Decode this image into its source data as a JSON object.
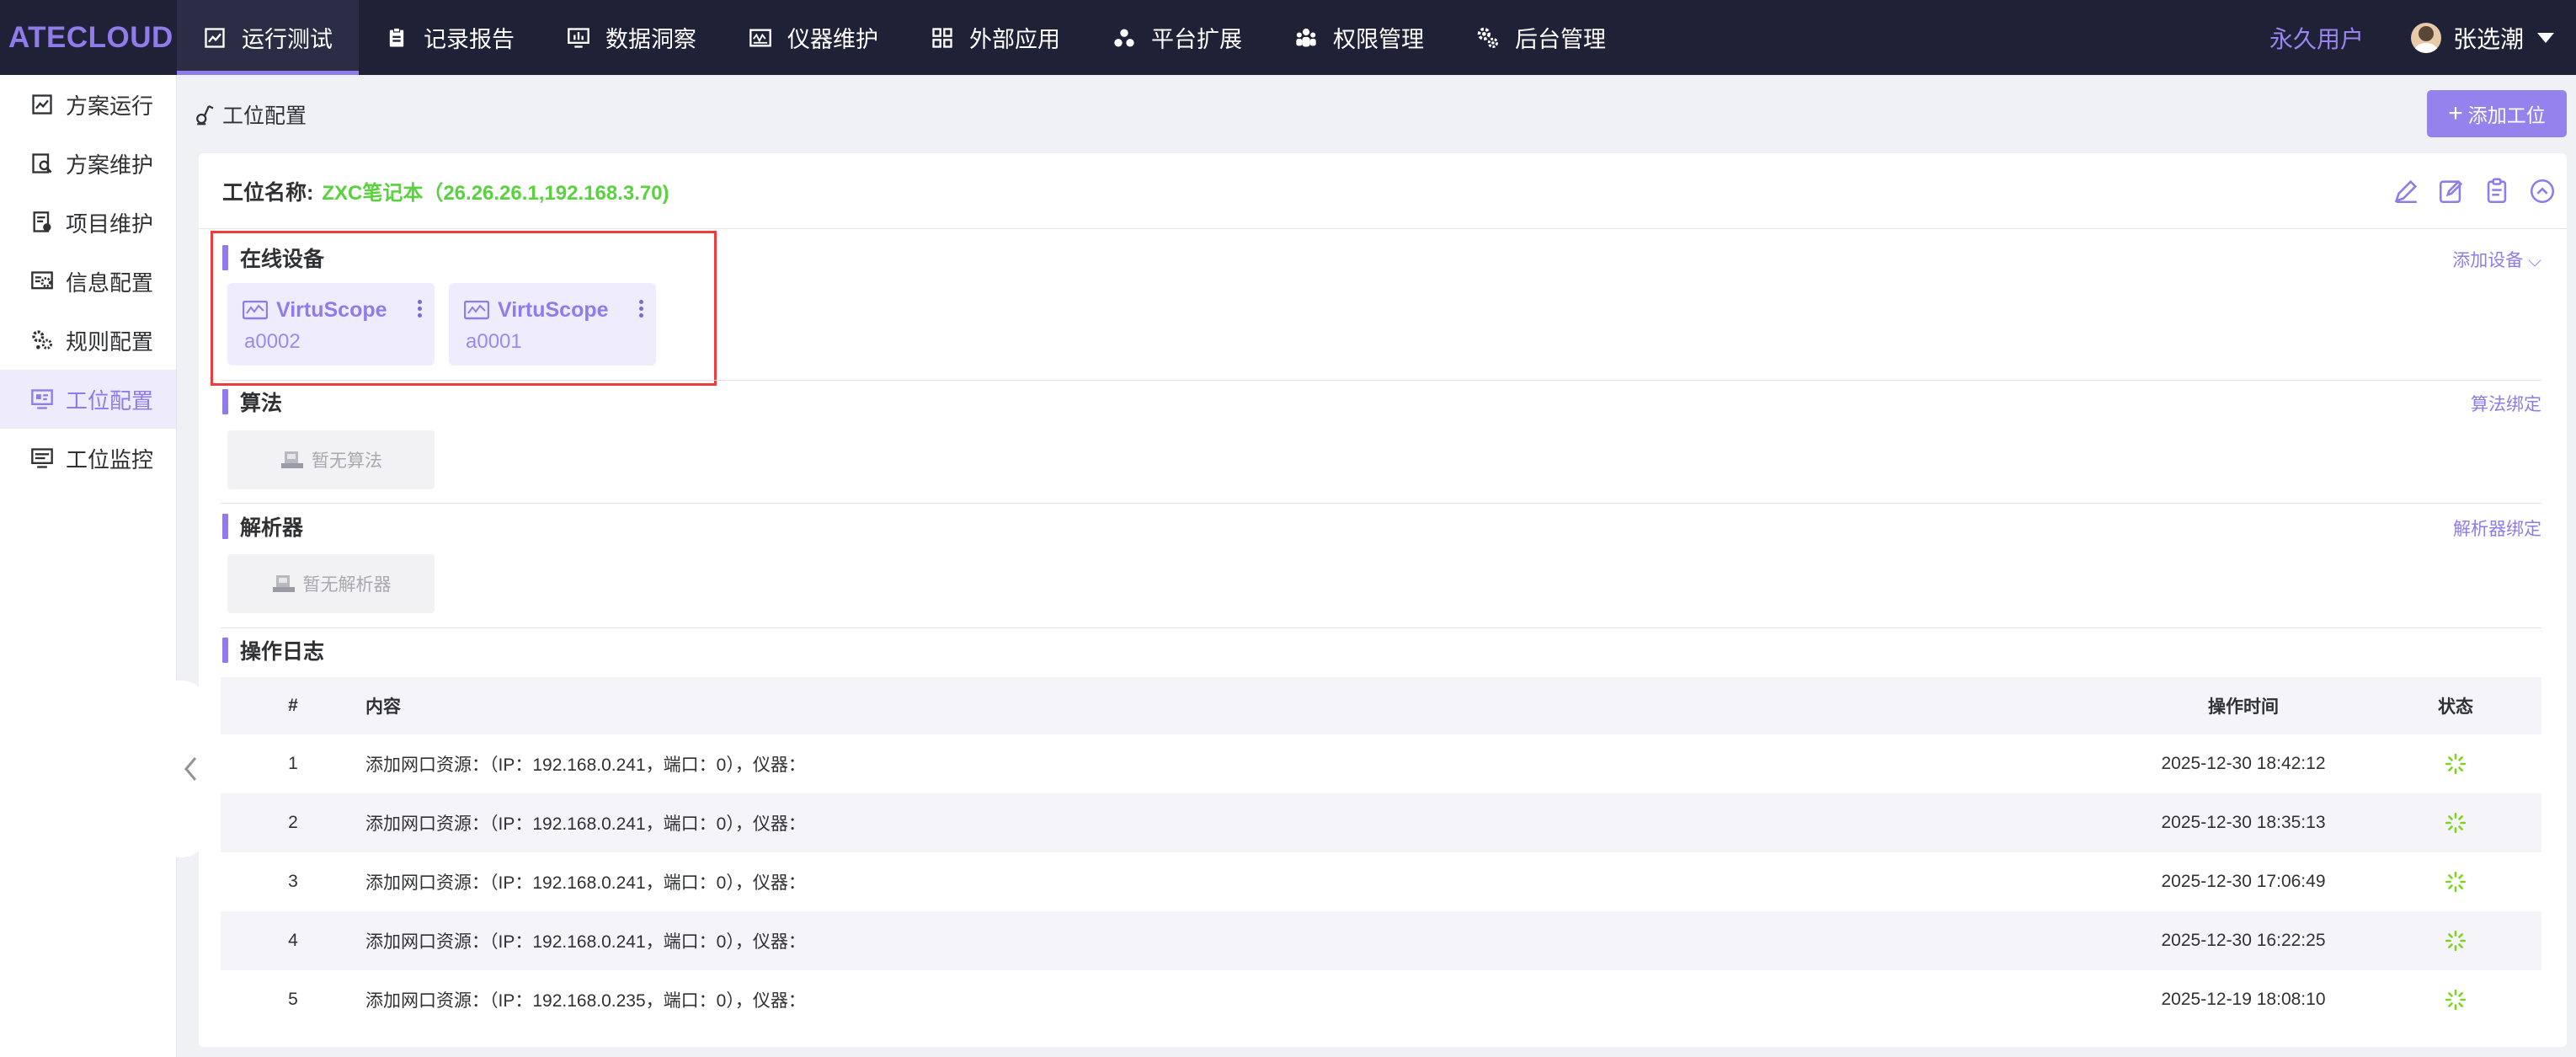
{
  "app": {
    "logo": "ATECLOUD"
  },
  "topnav": {
    "items": [
      {
        "label": "运行测试",
        "icon": "chart-line-icon",
        "active": true
      },
      {
        "label": "记录报告",
        "icon": "clipboard-icon"
      },
      {
        "label": "数据洞察",
        "icon": "monitor-chart-icon"
      },
      {
        "label": "仪器维护",
        "icon": "oscilloscope-icon"
      },
      {
        "label": "外部应用",
        "icon": "grid-apps-icon"
      },
      {
        "label": "平台扩展",
        "icon": "extension-icon"
      },
      {
        "label": "权限管理",
        "icon": "users-icon"
      },
      {
        "label": "后台管理",
        "icon": "gears-icon"
      }
    ],
    "role": "永久用户",
    "user_name": "张选潮"
  },
  "sidebar": {
    "items": [
      {
        "label": "方案运行",
        "icon": "chart-icon"
      },
      {
        "label": "方案维护",
        "icon": "search-doc-icon"
      },
      {
        "label": "项目维护",
        "icon": "project-icon"
      },
      {
        "label": "信息配置",
        "icon": "info-config-icon"
      },
      {
        "label": "规则配置",
        "icon": "rules-icon"
      },
      {
        "label": "工位配置",
        "icon": "workstation-icon",
        "active": true
      },
      {
        "label": "工位监控",
        "icon": "monitor-icon"
      }
    ]
  },
  "page": {
    "title": "工位配置",
    "add_button": "添加工位"
  },
  "station": {
    "label": "工位名称:",
    "value": "ZXC笔记本（26.26.26.1,192.168.3.70)"
  },
  "online_devices": {
    "title": "在线设备",
    "link": "添加设备",
    "devices": [
      {
        "name": "VirtuScope",
        "id": "a0002"
      },
      {
        "name": "VirtuScope",
        "id": "a0001"
      }
    ]
  },
  "algorithm": {
    "title": "算法",
    "link": "算法绑定",
    "empty": "暂无算法"
  },
  "parser": {
    "title": "解析器",
    "link": "解析器绑定",
    "empty": "暂无解析器"
  },
  "log": {
    "title": "操作日志",
    "columns": {
      "idx": "#",
      "content": "内容",
      "time": "操作时间",
      "status": "状态"
    },
    "rows": [
      {
        "idx": "1",
        "content": "添加网口资源：（IP：192.168.0.241，端口：0），仪器：",
        "time": "2025-12-30 18:42:12"
      },
      {
        "idx": "2",
        "content": "添加网口资源：（IP：192.168.0.241，端口：0），仪器：",
        "time": "2025-12-30 18:35:13"
      },
      {
        "idx": "3",
        "content": "添加网口资源：（IP：192.168.0.241，端口：0），仪器：",
        "time": "2025-12-30 17:06:49"
      },
      {
        "idx": "4",
        "content": "添加网口资源：（IP：192.168.0.241，端口：0），仪器：",
        "time": "2025-12-30 16:22:25"
      },
      {
        "idx": "5",
        "content": "添加网口资源：（IP：192.168.0.235，端口：0），仪器：",
        "time": "2025-12-19 18:08:10"
      }
    ]
  },
  "colors": {
    "accent": "#8f7bea",
    "topbar": "#1f2236",
    "station_value": "#5ad13e",
    "highlight": "#ee3b3b",
    "status_spinner": "#7ed321"
  }
}
